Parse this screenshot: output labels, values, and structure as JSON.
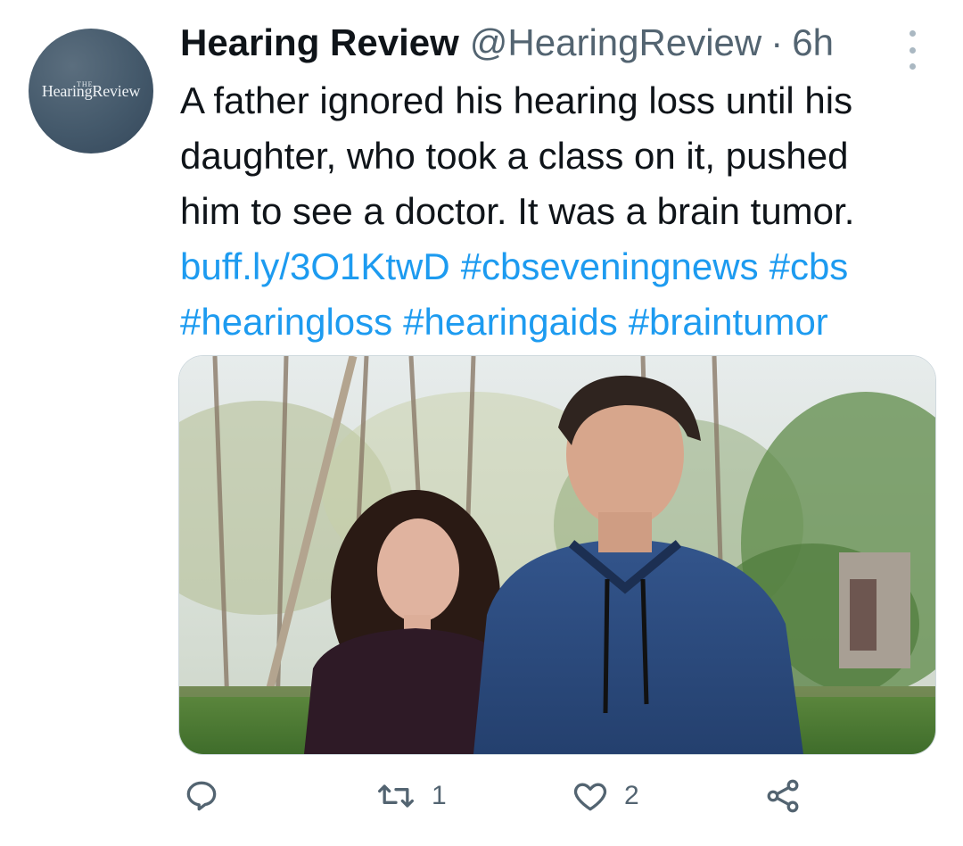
{
  "tweet": {
    "avatar": {
      "logo_small": "THE",
      "logo_main": "HearingReview",
      "color": "#44596b"
    },
    "author_name": "Hearing Review",
    "handle": "@HearingReview",
    "separator": "·",
    "time": "6h",
    "text_lines": [
      "A father ignored his hearing loss until his",
      "daughter, who took a class on it, pushed",
      "him to see a doctor. It was a brain tumor."
    ],
    "link": "buff.ly/3O1KtwD",
    "hashtags": [
      "#cbseveningnews",
      "#cbs",
      "#hearingloss",
      "#hearingaids",
      "#braintumor"
    ],
    "link_color": "#1d9bf0",
    "media": {
      "description_icon": "photo-of-father-and-daughter"
    },
    "actions": {
      "reply": {
        "icon": "reply-icon",
        "count": ""
      },
      "retweet": {
        "icon": "retweet-icon",
        "count": "1"
      },
      "like": {
        "icon": "heart-icon",
        "count": "2"
      },
      "share": {
        "icon": "share-icon",
        "count": ""
      }
    }
  }
}
